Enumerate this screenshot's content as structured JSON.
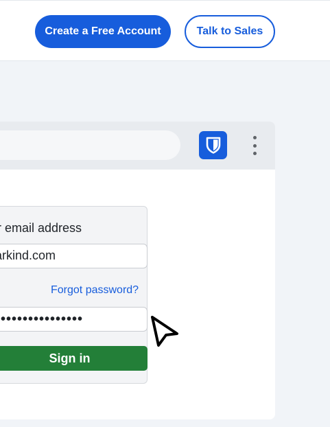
{
  "header": {
    "cta_primary": "Create a Free Account",
    "cta_secondary": "Talk to Sales"
  },
  "login": {
    "email_label": "r email address",
    "email_value": "starkind.com",
    "forgot_link": "Forgot password?",
    "password_value": "•••••••••••••••",
    "signin_label": "Sign in"
  },
  "colors": {
    "brand_blue": "#175ddc",
    "signin_green": "#237f38",
    "page_bg": "#f1f4f8"
  },
  "icons": {
    "extension": "shield-icon",
    "menu": "more-vertical-icon",
    "cursor": "mouse-pointer-icon"
  }
}
